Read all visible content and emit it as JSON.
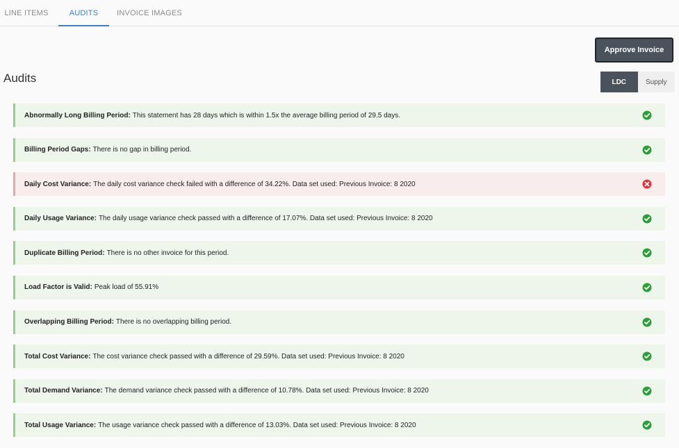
{
  "tabs": [
    {
      "label": "LINE ITEMS",
      "active": false
    },
    {
      "label": "AUDITS",
      "active": true
    },
    {
      "label": "INVOICE IMAGES",
      "active": false
    }
  ],
  "header": {
    "title": "Audits",
    "approve_label": "Approve Invoice",
    "toggle": [
      {
        "label": "LDC",
        "active": true
      },
      {
        "label": "Supply",
        "active": false
      }
    ]
  },
  "colors": {
    "accent": "#3b7fc4",
    "pass_icon": "#2e9e3a",
    "fail_icon": "#e0343c",
    "dark_button": "#4a525c"
  },
  "audits": [
    {
      "name": "Abnormally Long Billing Period:",
      "message": "This statement has 28 days which is within 1.5x the average billing period of 29.5 days.",
      "status": "pass",
      "icon": "check-circle-icon"
    },
    {
      "name": "Billing Period Gaps:",
      "message": "There is no gap in billing period.",
      "status": "pass",
      "icon": "check-circle-icon"
    },
    {
      "name": "Daily Cost Variance:",
      "message": "The daily cost variance check failed with a difference of 34.22%. Data set used: Previous Invoice: 8 2020",
      "status": "fail",
      "icon": "x-circle-icon"
    },
    {
      "name": "Daily Usage Variance:",
      "message": "The daily usage variance check passed with a difference of 17.07%. Data set used: Previous Invoice: 8 2020",
      "status": "pass",
      "icon": "check-circle-icon"
    },
    {
      "name": "Duplicate Billing Period:",
      "message": "There is no other invoice for this period.",
      "status": "pass",
      "icon": "check-circle-icon"
    },
    {
      "name": "Load Factor is Valid:",
      "message": "Peak load of 55.91%",
      "status": "pass",
      "icon": "check-circle-icon"
    },
    {
      "name": "Overlapping Billing Period:",
      "message": "There is no overlapping billing period.",
      "status": "pass",
      "icon": "check-circle-icon"
    },
    {
      "name": "Total Cost Variance:",
      "message": "The cost variance check passed with a difference of 29.59%. Data set used: Previous Invoice: 8 2020",
      "status": "pass",
      "icon": "check-circle-icon"
    },
    {
      "name": "Total Demand Variance:",
      "message": "The demand variance check passed with a difference of 10.78%. Data set used: Previous Invoice: 8 2020",
      "status": "pass",
      "icon": "check-circle-icon"
    },
    {
      "name": "Total Usage Variance:",
      "message": "The usage variance check passed with a difference of 13.03%. Data set used: Previous Invoice: 8 2020",
      "status": "pass",
      "icon": "check-circle-icon"
    }
  ]
}
